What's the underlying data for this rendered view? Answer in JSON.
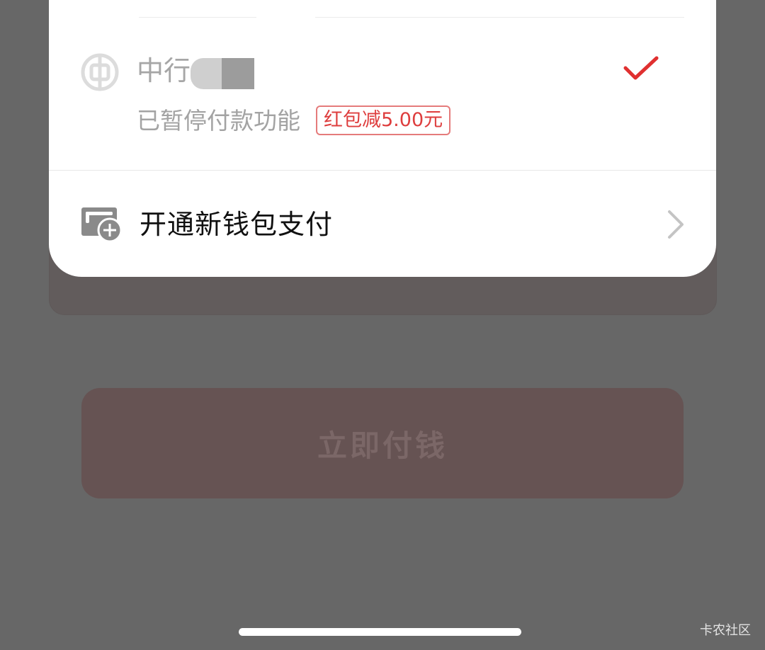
{
  "payment_sheet": {
    "bank": {
      "name": "中行",
      "status": "已暂停付款功能",
      "promo_tag": "红包减5.00元",
      "selected": true,
      "icon": "bank-of-china-icon"
    },
    "open_new_wallet": {
      "label": "开通新钱包支付",
      "icon": "wallet-add-icon"
    }
  },
  "pay_button": {
    "label": "立即付钱"
  },
  "watermark": "卡农社区",
  "colors": {
    "overlay": "#676767",
    "accent_red": "#de3e3e",
    "check_red": "#e03030"
  }
}
